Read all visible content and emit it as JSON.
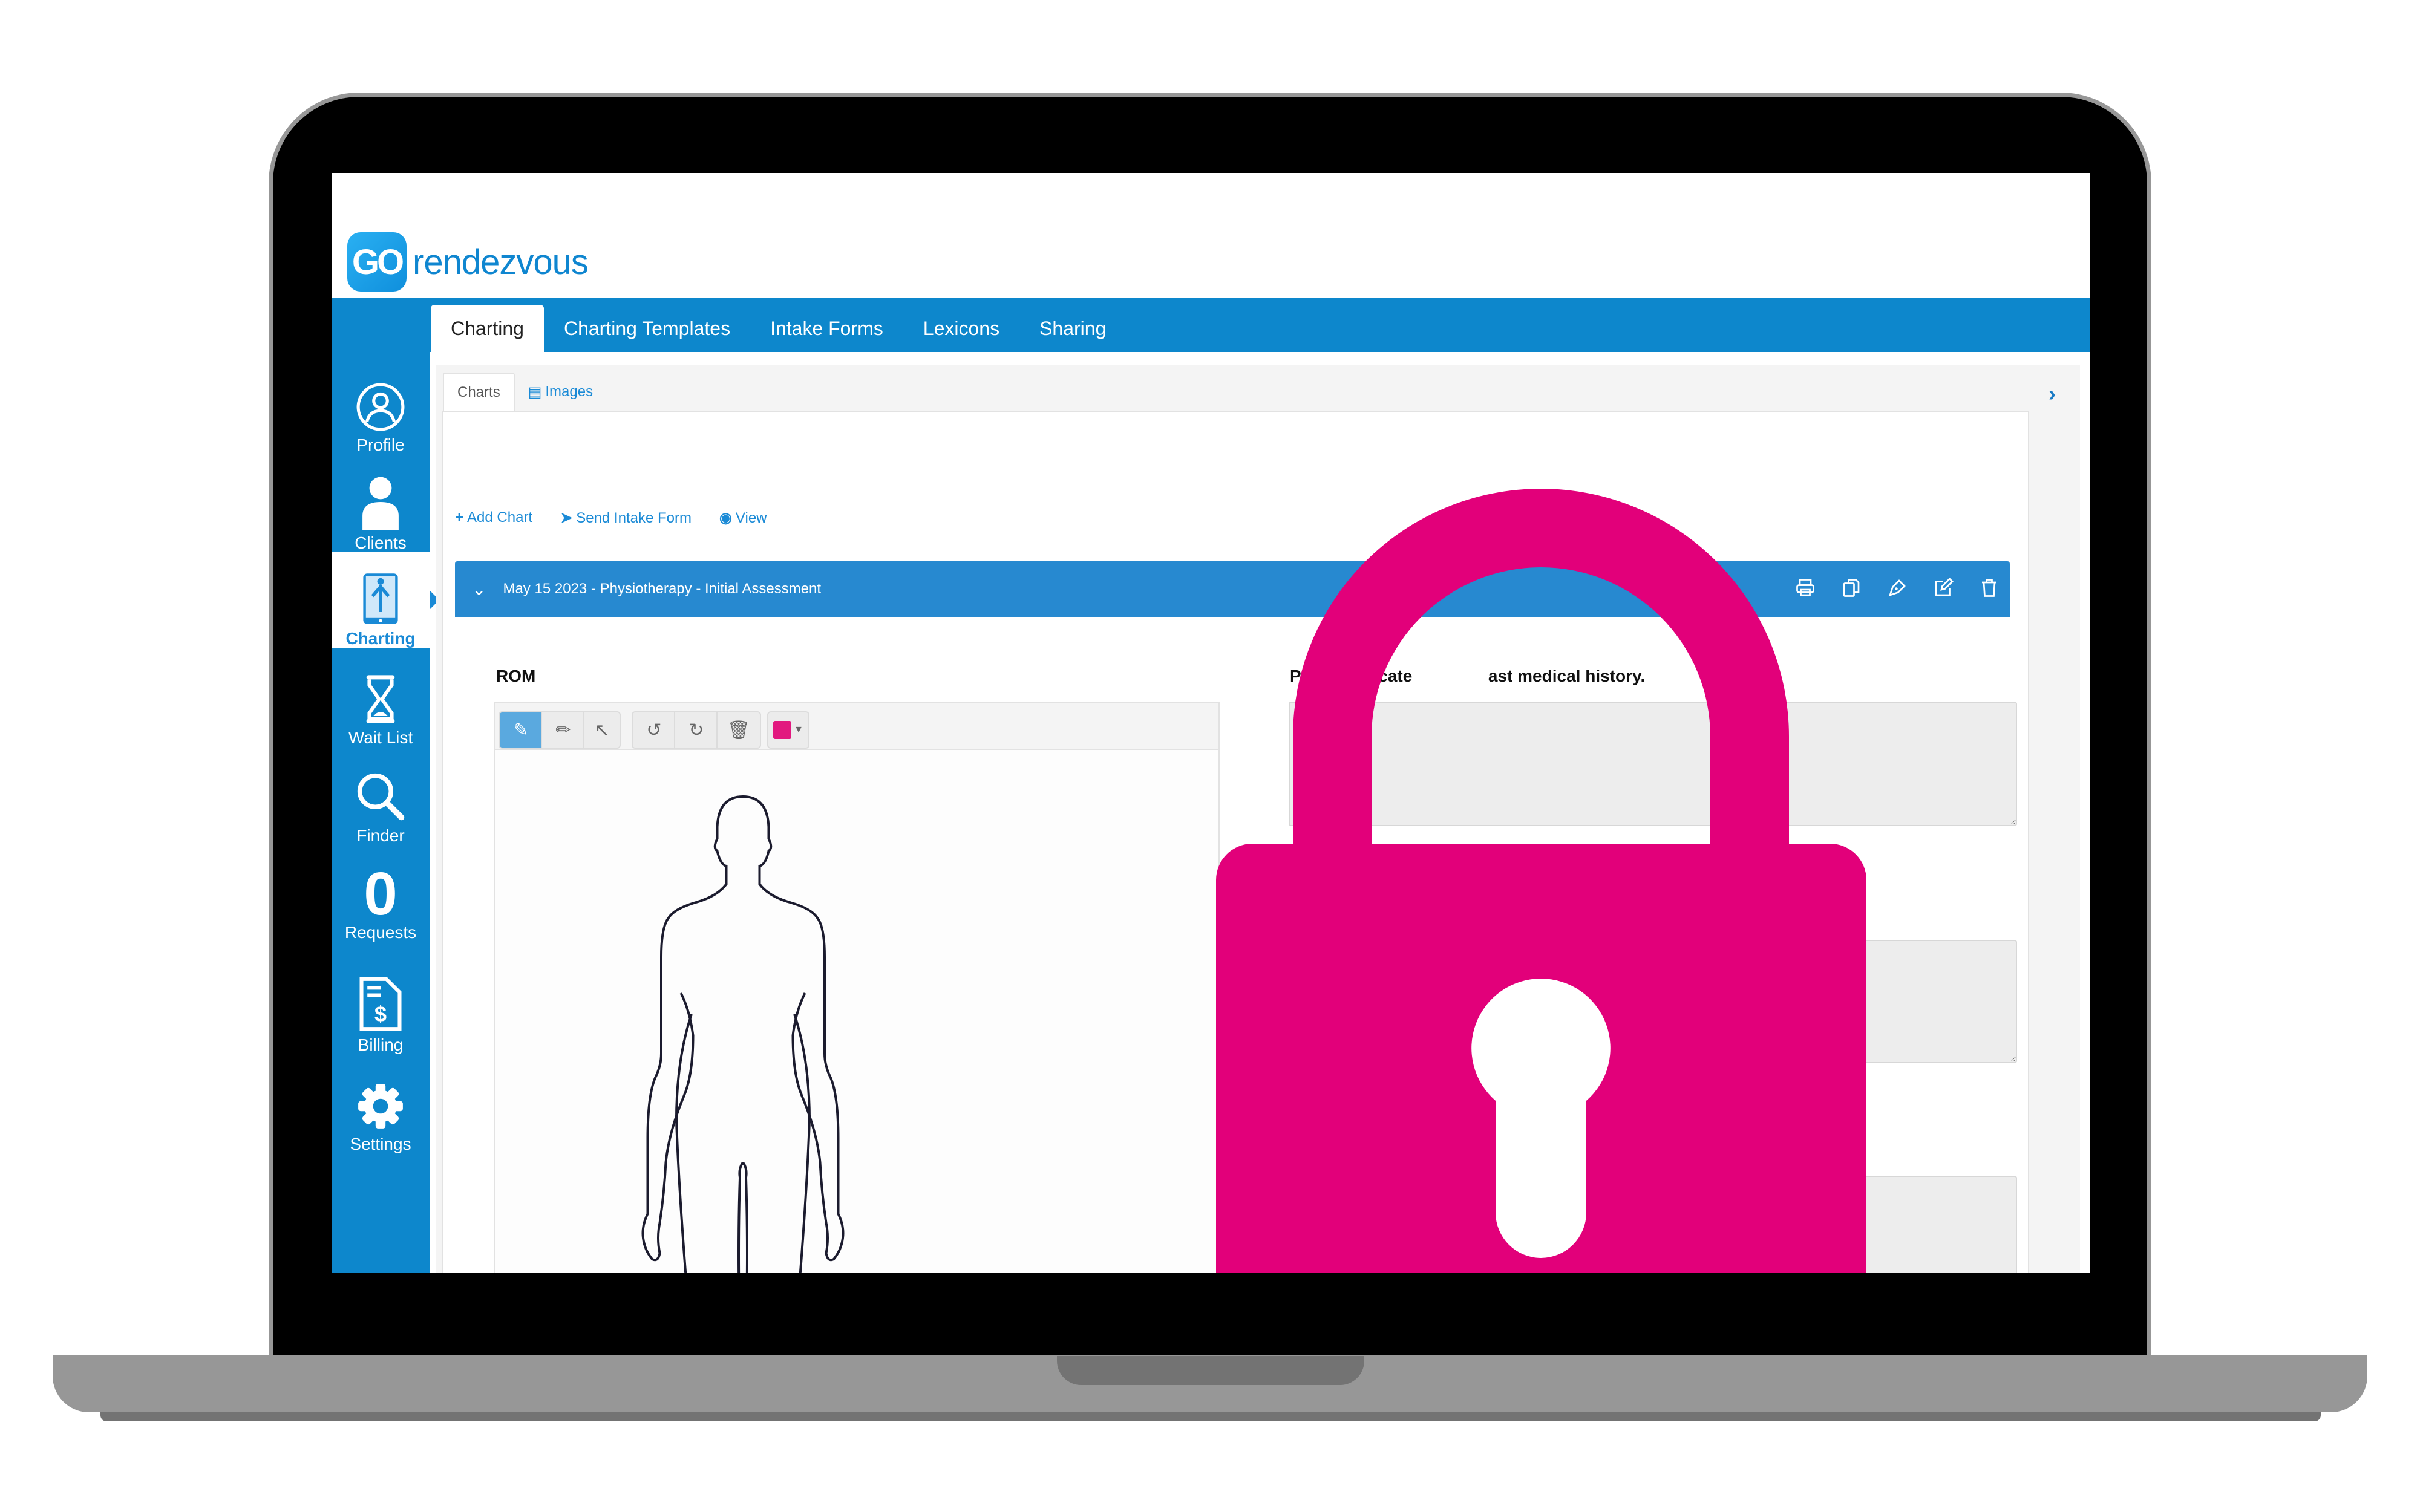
{
  "app": {
    "logo_badge": "GO",
    "logo_text": "rendezvous"
  },
  "top_nav": {
    "tabs": [
      {
        "label": "Charting",
        "active": true
      },
      {
        "label": "Charting Templates",
        "active": false
      },
      {
        "label": "Intake Forms",
        "active": false
      },
      {
        "label": "Lexicons",
        "active": false
      },
      {
        "label": "Sharing",
        "active": false
      }
    ]
  },
  "sidebar": {
    "items": [
      {
        "label": "Profile",
        "icon": "profile-icon"
      },
      {
        "label": "Clients",
        "icon": "user-icon"
      },
      {
        "label": "Charting",
        "icon": "charting-tablet-icon",
        "active": true
      },
      {
        "label": "Wait List",
        "icon": "hourglass-icon"
      },
      {
        "label": "Finder",
        "icon": "search-icon"
      },
      {
        "label": "Requests",
        "icon": "count",
        "count": "0"
      },
      {
        "label": "Billing",
        "icon": "invoice-dollar-icon"
      },
      {
        "label": "Settings",
        "icon": "gear-icon"
      }
    ]
  },
  "sub_tabs": [
    {
      "label": "Charts",
      "active": true
    },
    {
      "label": "Images",
      "icon": "images-icon",
      "active": false
    }
  ],
  "actions": [
    {
      "label": "Add Chart",
      "icon": "plus-icon"
    },
    {
      "label": "Send Intake Form",
      "icon": "send-icon"
    },
    {
      "label": "View",
      "icon": "eye-icon"
    }
  ],
  "chart_entry": {
    "title": "May 15 2023 - Physiotherapy - Initial Assessment",
    "toolbar_icons": [
      "print-icon",
      "copy-icon",
      "sign-pen-icon",
      "edit-icon",
      "trash-icon"
    ]
  },
  "rom": {
    "label": "ROM",
    "draw_tools": [
      "highlighter-icon",
      "pencil-icon",
      "pointer-icon",
      "undo-icon",
      "redo-icon",
      "trash-icon"
    ],
    "active_tool": "highlighter-icon",
    "pen_color": "#e2197f"
  },
  "form": {
    "question_visible_text": "Please indicate ... past medical history.",
    "question_left": "Please indicate",
    "question_right": "ast medical history.",
    "textarea_values": [
      "",
      "",
      ""
    ]
  },
  "overlay": {
    "icon": "padlock-icon",
    "color": "#e2007a"
  },
  "colors": {
    "brand_blue": "#0d87cc",
    "chart_bar": "#2789d0",
    "lock_pink": "#e2007a",
    "laptop_gray": "#979797"
  }
}
